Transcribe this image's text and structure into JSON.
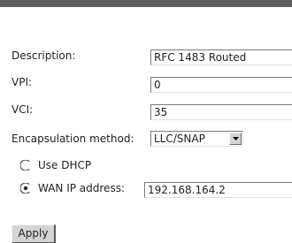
{
  "form": {
    "description": {
      "label": "Description:",
      "value": "RFC 1483 Routed"
    },
    "vpi": {
      "label": "VPI:",
      "value": "0"
    },
    "vci": {
      "label": "VCI:",
      "value": "35"
    },
    "encapsulation": {
      "label": "Encapsulation method:",
      "selected": "LLC/SNAP"
    },
    "ip_mode": {
      "dhcp_label": "Use DHCP",
      "wan_label": "WAN IP address:",
      "selected": "wan",
      "wan_ip": "192.168.164.2"
    },
    "apply_label": "Apply"
  },
  "icons": {
    "radio_unselected": "radio-unselected-icon",
    "radio_selected": "radio-selected-icon",
    "dropdown": "triangle-down-icon"
  }
}
